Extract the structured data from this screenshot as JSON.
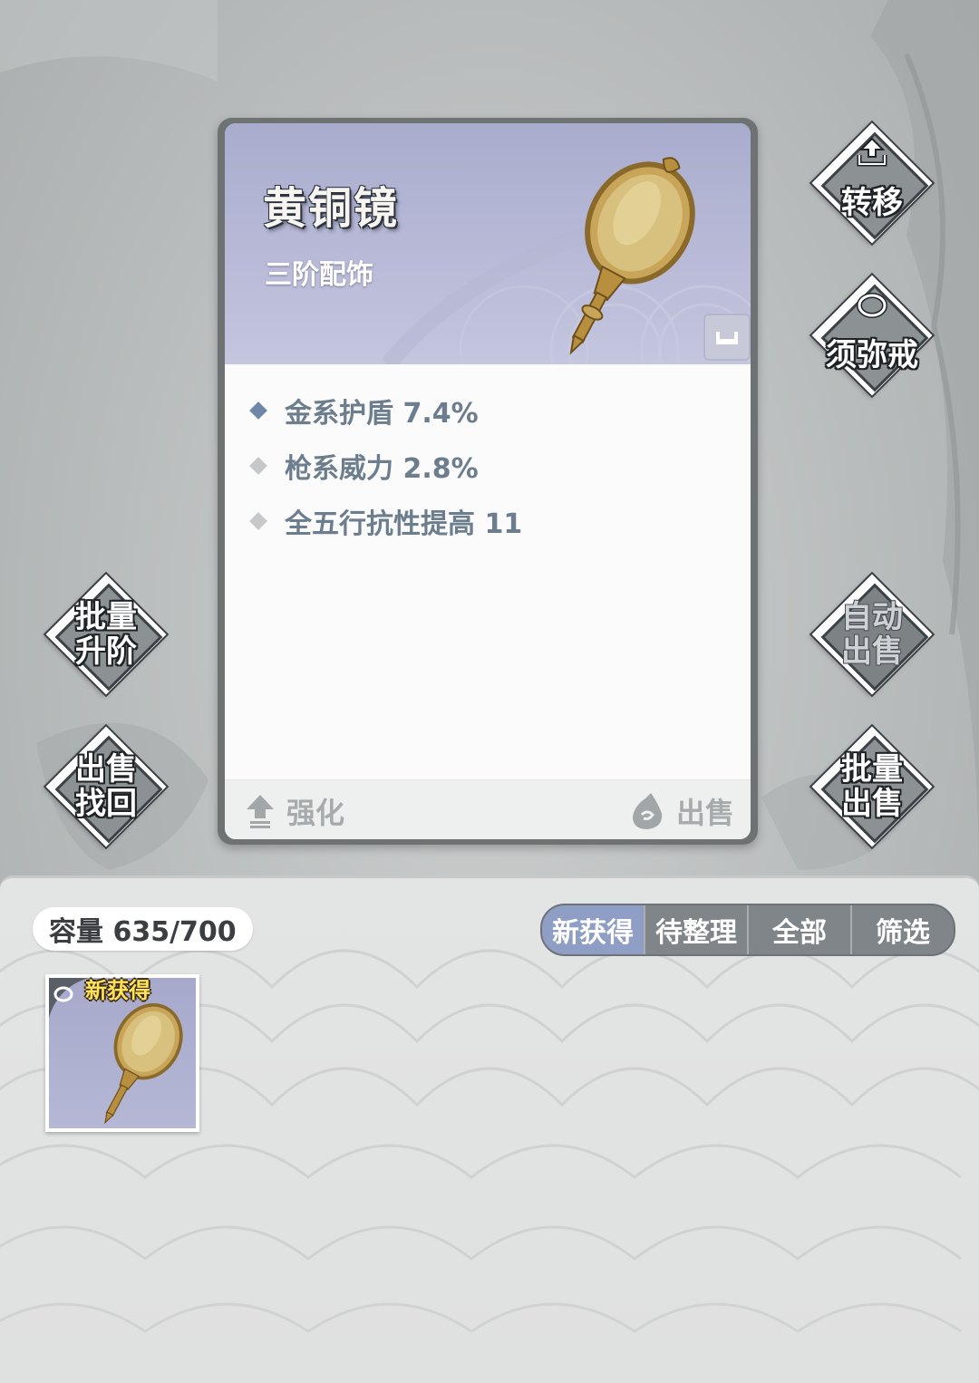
{
  "item": {
    "name": "黄铜镜",
    "grade": "三阶配饰",
    "stats": [
      {
        "text": "金系护盾 7.4%",
        "diamond_color": "#6e87a6"
      },
      {
        "text": "枪系威力 2.8%",
        "diamond_color": "#c6c8c9"
      },
      {
        "text": "全五行抗性提高 11",
        "diamond_color": "#c6c8c9"
      }
    ],
    "footer": {
      "enhance_label": "强化",
      "sell_label": "出售"
    }
  },
  "side_buttons": {
    "transfer": "转移",
    "ring": "须弥戒",
    "batch_upgrade": [
      "批量",
      "升阶"
    ],
    "sell_recover": [
      "出售",
      "找回"
    ],
    "auto_sell": [
      "自动",
      "出售"
    ],
    "batch_sell": [
      "批量",
      "出售"
    ]
  },
  "inventory": {
    "capacity": "容量 635/700",
    "tabs": [
      "新获得",
      "待整理",
      "全部",
      "筛选"
    ],
    "active_tab": "新获得",
    "slot_tag": "新获得"
  },
  "colors": {
    "header_bg": "#a9accd",
    "accent_tab": "#8f9ec4",
    "stat_text": "#6c7d8e"
  }
}
